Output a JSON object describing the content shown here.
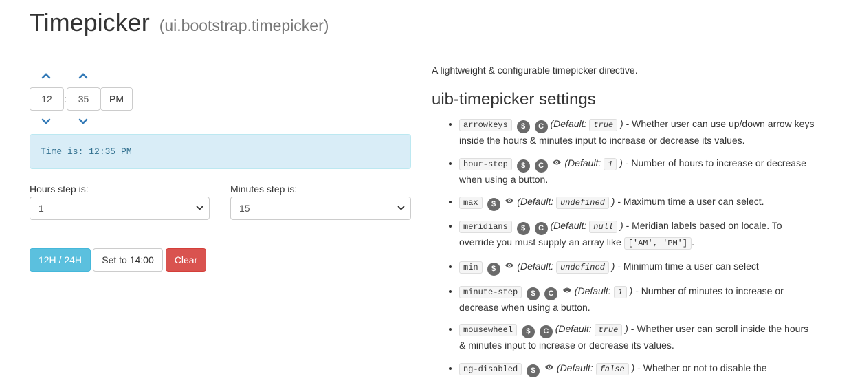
{
  "page": {
    "title": "Timepicker",
    "subtitle": "(ui.bootstrap.timepicker)"
  },
  "timepicker": {
    "hours": "12",
    "separator": ":",
    "minutes": "35",
    "meridian": "PM",
    "up_icon": "chevron-up-icon",
    "down_icon": "chevron-down-icon"
  },
  "alert": {
    "text": "Time is: 12:35 PM"
  },
  "hours_step": {
    "label": "Hours step is:",
    "value": "1"
  },
  "minutes_step": {
    "label": "Minutes step is:",
    "value": "15"
  },
  "buttons": {
    "toggle": "12H / 24H",
    "set": "Set to 14:00",
    "clear": "Clear"
  },
  "colors": {
    "info": "#5bc0de",
    "danger": "#d9534f",
    "alert_bg": "#d9edf7",
    "alert_text": "#31708f",
    "badge": "#6a6a6a"
  },
  "docs": {
    "description": "A lightweight & configurable timepicker directive.",
    "heading": "uib-timepicker settings",
    "default_label": "Default:",
    "badge_dollar": "$",
    "badge_c": "C",
    "eye_icon": "eye-icon",
    "items": [
      {
        "name": "arrowkeys",
        "default": "true",
        "text": "- Whether user can use up/down arrow keys inside the hours & minutes input to increase or decrease its values."
      },
      {
        "name": "hour-step",
        "default": "1",
        "text": "- Number of hours to increase or decrease when using a button."
      },
      {
        "name": "max",
        "default": "undefined",
        "text": "- Maximum time a user can select."
      },
      {
        "name": "meridians",
        "default": "null",
        "text": "- Meridian labels based on locale. To override you must supply an array like",
        "code2": "['AM', 'PM']",
        "tail": "."
      },
      {
        "name": "min",
        "default": "undefined",
        "text": "- Minimum time a user can select"
      },
      {
        "name": "minute-step",
        "default": "1",
        "text": "- Number of minutes to increase or decrease when using a button."
      },
      {
        "name": "mousewheel",
        "default": "true",
        "text": "- Whether user can scroll inside the hours & minutes input to increase or decrease its values."
      },
      {
        "name": "ng-disabled",
        "default": "false",
        "text": "- Whether or not to disable the"
      }
    ]
  }
}
